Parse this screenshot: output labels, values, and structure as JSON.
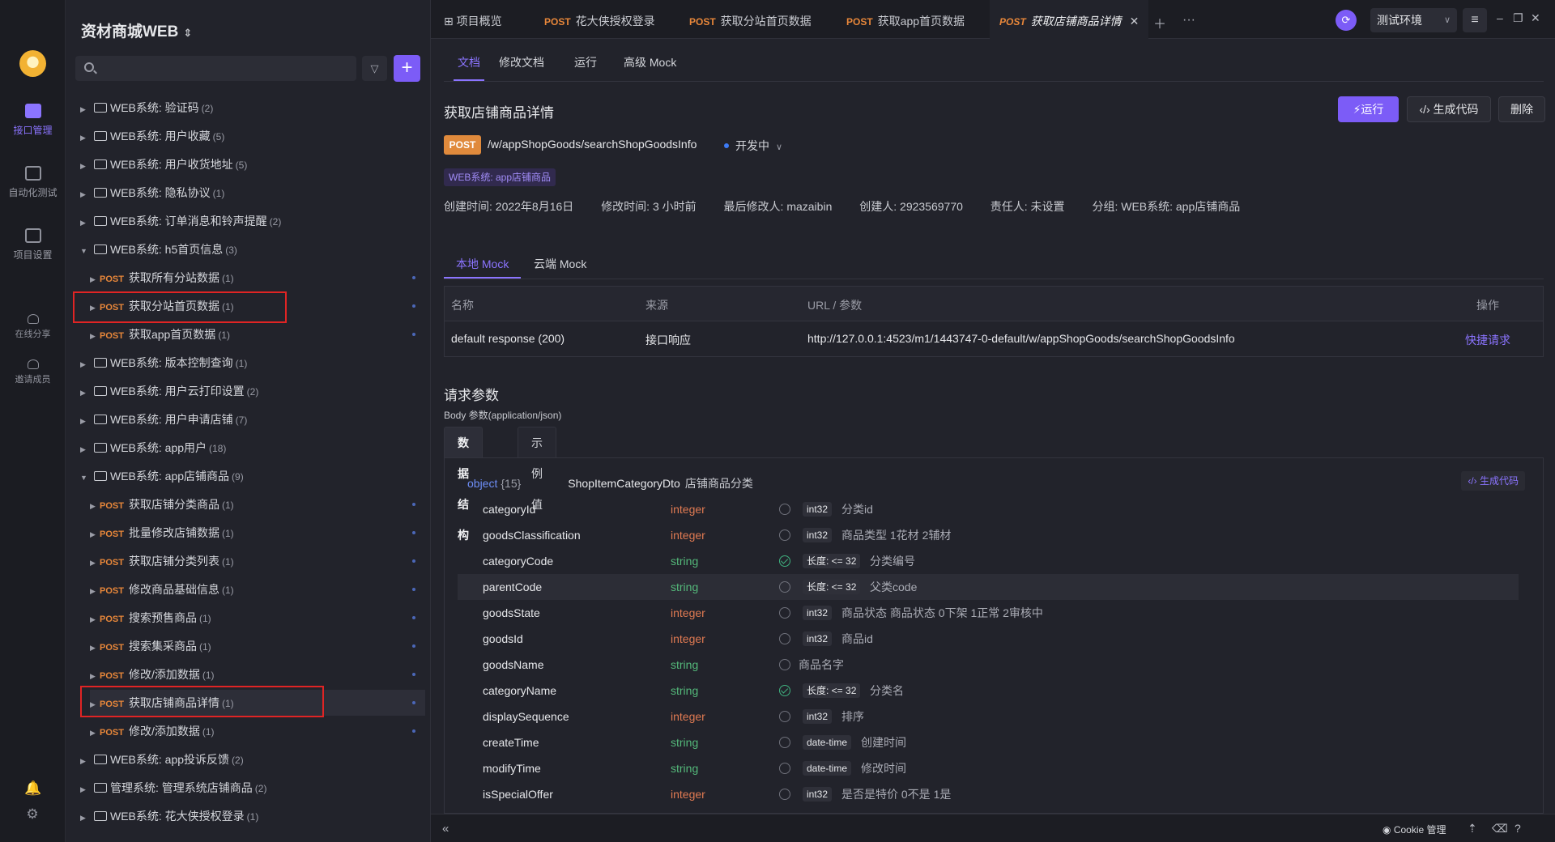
{
  "rail": {
    "items": [
      {
        "label": "接口管理",
        "icon": "api-grid-icon",
        "active": true
      },
      {
        "label": "自动化测试",
        "icon": "test-stack-icon",
        "active": false
      },
      {
        "label": "项目设置",
        "icon": "settings-icon",
        "active": false
      }
    ],
    "small_items": [
      {
        "label": "在线分享",
        "icon": "share-icon"
      },
      {
        "label": "邀请成员",
        "icon": "invite-icon"
      }
    ]
  },
  "sidebar": {
    "project_name": "资材商城WEB",
    "search": {
      "placeholder": "",
      "value": ""
    },
    "tree": [
      {
        "label": "WEB系统: 验证码",
        "count": "(2)",
        "type": "folder",
        "expanded": false
      },
      {
        "label": "WEB系统: 用户收藏",
        "count": "(5)",
        "type": "folder",
        "expanded": false
      },
      {
        "label": "WEB系统: 用户收货地址",
        "count": "(5)",
        "type": "folder",
        "expanded": false
      },
      {
        "label": "WEB系统: 隐私协议",
        "count": "(1)",
        "type": "folder",
        "expanded": false
      },
      {
        "label": "WEB系统: 订单消息和铃声提醒",
        "count": "(2)",
        "type": "folder",
        "expanded": false
      },
      {
        "label": "WEB系统: h5首页信息",
        "count": "(3)",
        "type": "folder",
        "expanded": true
      },
      {
        "method": "POST",
        "label": "获取所有分站数据",
        "count": "(1)",
        "type": "api"
      },
      {
        "method": "POST",
        "label": "获取分站首页数据",
        "count": "(1)",
        "type": "api"
      },
      {
        "method": "POST",
        "label": "获取app首页数据",
        "count": "(1)",
        "type": "api"
      },
      {
        "label": "WEB系统: 版本控制查询",
        "count": "(1)",
        "type": "folder",
        "expanded": false
      },
      {
        "label": "WEB系统: 用户云打印设置",
        "count": "(2)",
        "type": "folder",
        "expanded": false
      },
      {
        "label": "WEB系统: 用户申请店铺",
        "count": "(7)",
        "type": "folder",
        "expanded": false
      },
      {
        "label": "WEB系统: app用户",
        "count": "(18)",
        "type": "folder",
        "expanded": false
      },
      {
        "label": "WEB系统: app店铺商品",
        "count": "(9)",
        "type": "folder",
        "expanded": true
      },
      {
        "method": "POST",
        "label": "获取店铺分类商品",
        "count": "(1)",
        "type": "api"
      },
      {
        "method": "POST",
        "label": "批量修改店铺数据",
        "count": "(1)",
        "type": "api"
      },
      {
        "method": "POST",
        "label": "获取店铺分类列表",
        "count": "(1)",
        "type": "api"
      },
      {
        "method": "POST",
        "label": "修改商品基础信息",
        "count": "(1)",
        "type": "api"
      },
      {
        "method": "POST",
        "label": "搜索预售商品",
        "count": "(1)",
        "type": "api"
      },
      {
        "method": "POST",
        "label": "搜索集采商品",
        "count": "(1)",
        "type": "api"
      },
      {
        "method": "POST",
        "label": "修改/添加数据",
        "count": "(1)",
        "type": "api"
      },
      {
        "method": "POST",
        "label": "获取店铺商品详情",
        "count": "(1)",
        "type": "api"
      },
      {
        "method": "POST",
        "label": "修改/添加数据",
        "count": "(1)",
        "type": "api"
      },
      {
        "label": "WEB系统: app投诉反馈",
        "count": "(2)",
        "type": "folder",
        "expanded": false
      },
      {
        "label": "管理系统: 管理系统店铺商品",
        "count": "(2)",
        "type": "folder",
        "expanded": false
      },
      {
        "label": "WEB系统: 花大侠授权登录",
        "count": "(1)",
        "type": "folder",
        "expanded": false
      }
    ]
  },
  "tabs": [
    {
      "method": "",
      "label": "项目概览",
      "icon": "overview-icon"
    },
    {
      "method": "POST",
      "label": "花大侠授权登录"
    },
    {
      "method": "POST",
      "label": "获取分站首页数据"
    },
    {
      "method": "POST",
      "label": "获取app首页数据"
    },
    {
      "method": "POST",
      "label": "获取店铺商品详情",
      "active": true
    }
  ],
  "env": {
    "label": "测试环境"
  },
  "subtabs": [
    "文档",
    "修改文档",
    "运行",
    "高级 Mock"
  ],
  "api": {
    "title": "获取店铺商品详情",
    "method": "POST",
    "path": "/w/appShopGoods/searchShopGoodsInfo",
    "status": "开发中",
    "group_tag": "WEB系统: app店铺商品",
    "run_label": "运行",
    "code_label": "生成代码",
    "delete_label": "删除",
    "meta": {
      "created": "创建时间: 2022年8月16日",
      "modified": "修改时间: 3 小时前",
      "modifier": "最后修改人: mazaibin",
      "creator": "创建人: 2923569770",
      "owner": "责任人: 未设置",
      "group": "分组: WEB系统: app店铺商品"
    }
  },
  "mock": {
    "tabs": [
      "本地 Mock",
      "云端 Mock"
    ],
    "headers": {
      "name": "名称",
      "source": "来源",
      "url": "URL / 参数",
      "action": "操作"
    },
    "row": {
      "name": "default response (200)",
      "source": "接口响应",
      "url": "http://127.0.0.1:4523/m1/1443747-0-default/w/appShopGoods/searchShopGoodsInfo",
      "action": "快捷请求"
    }
  },
  "request": {
    "title": "请求参数",
    "body_label": "Body 参数(application/json)",
    "tabs": [
      "数据结构",
      "示例值"
    ],
    "root_type": "object",
    "root_count": "{15}",
    "dto_name": "ShopItemCategoryDto",
    "dto_desc": "店铺商品分类",
    "gen_code": "生成代码",
    "fields": [
      {
        "name": "categoryId",
        "type": "integer",
        "required": false,
        "format": "int32",
        "desc": "分类id"
      },
      {
        "name": "goodsClassification",
        "type": "integer",
        "required": false,
        "format": "int32",
        "desc": "商品类型 1花材 2辅材"
      },
      {
        "name": "categoryCode",
        "type": "string",
        "required": true,
        "format": "长度: <= 32",
        "desc": "分类编号"
      },
      {
        "name": "parentCode",
        "type": "string",
        "required": false,
        "format": "长度: <= 32",
        "desc": "父类code"
      },
      {
        "name": "goodsState",
        "type": "integer",
        "required": false,
        "format": "int32",
        "desc": "商品状态 商品状态 0下架 1正常 2审核中"
      },
      {
        "name": "goodsId",
        "type": "integer",
        "required": false,
        "format": "int32",
        "desc": "商品id"
      },
      {
        "name": "goodsName",
        "type": "string",
        "required": false,
        "format": "",
        "desc": "商品名字"
      },
      {
        "name": "categoryName",
        "type": "string",
        "required": true,
        "format": "长度: <= 32",
        "desc": "分类名"
      },
      {
        "name": "displaySequence",
        "type": "integer",
        "required": false,
        "format": "int32",
        "desc": "排序"
      },
      {
        "name": "createTime",
        "type": "string",
        "required": false,
        "format": "date-time",
        "desc": "创建时间"
      },
      {
        "name": "modifyTime",
        "type": "string",
        "required": false,
        "format": "date-time",
        "desc": "修改时间"
      },
      {
        "name": "isSpecialOffer",
        "type": "integer",
        "required": false,
        "format": "int32",
        "desc": "是否是特价 0不是 1是"
      }
    ]
  },
  "footer": {
    "cookie": "Cookie 管理"
  },
  "colors": {
    "accent": "#7c5cf7",
    "method_post": "#e8873a",
    "highlight_box": "#e02424"
  }
}
